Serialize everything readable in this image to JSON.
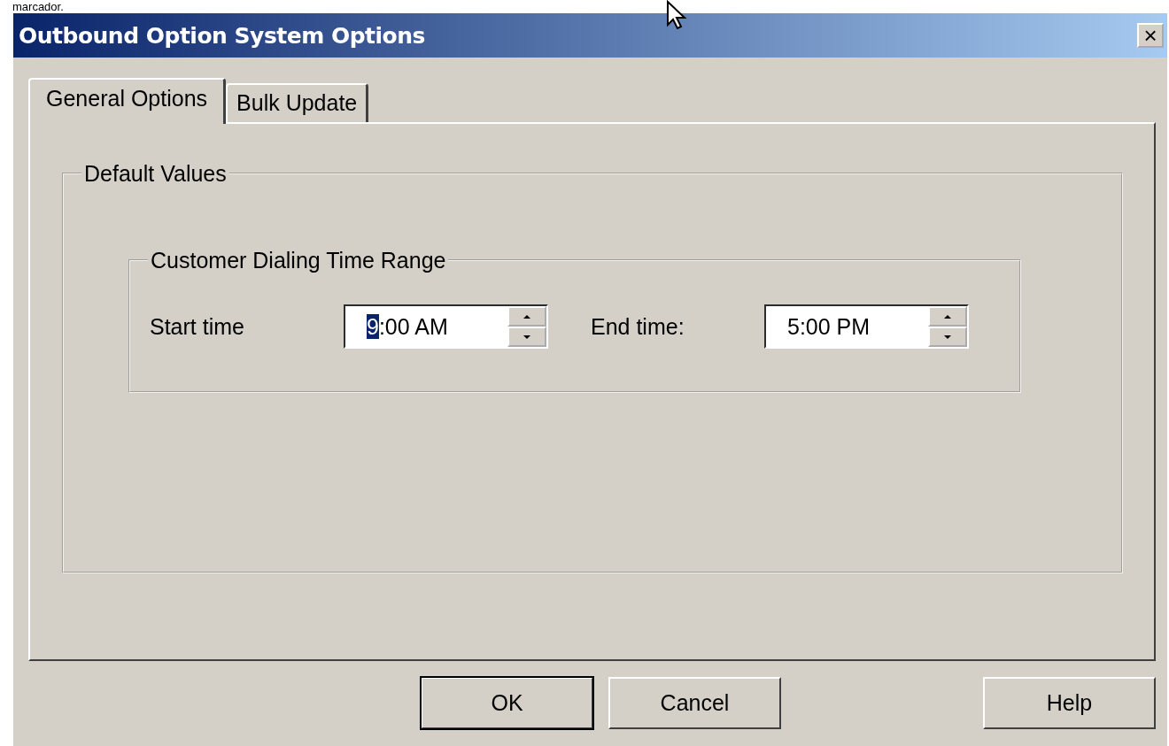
{
  "caption": "marcador.",
  "window": {
    "title": "Outbound Option System Options",
    "close": "×"
  },
  "tabs": [
    {
      "label": "General Options",
      "selected": true
    },
    {
      "label": "Bulk Update",
      "selected": false
    }
  ],
  "group": {
    "label": "Default Values",
    "subgroup": {
      "label": "Customer Dialing Time Range",
      "fields": [
        {
          "label": "Start time",
          "value": "9:00 AM",
          "first_char_selected": true
        },
        {
          "label": "End time:",
          "value": "5:00 PM",
          "first_char_selected": false
        }
      ]
    }
  },
  "buttons": [
    {
      "label": "OK",
      "default": true,
      "kind": "left"
    },
    {
      "label": "Cancel",
      "default": false,
      "kind": "left"
    },
    {
      "label": "Help",
      "default": false,
      "kind": "right"
    }
  ]
}
